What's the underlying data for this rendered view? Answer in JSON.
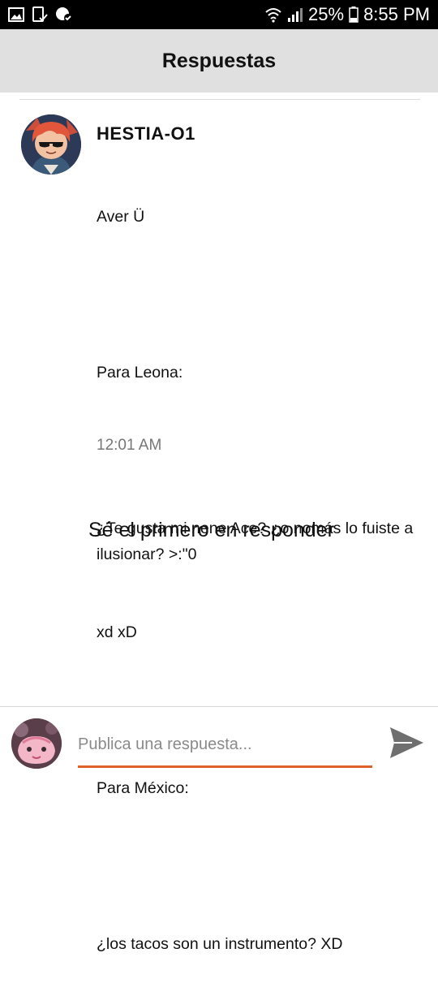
{
  "status_bar": {
    "battery": "25%",
    "time": "8:55 PM",
    "icons": [
      "image-icon",
      "phone-check-icon",
      "location-icon",
      "wifi-icon",
      "signal-icon",
      "battery-icon"
    ]
  },
  "header": {
    "title": "Respuestas"
  },
  "comment": {
    "author": "HESTIA-O1",
    "lines": [
      "Aver Ü",
      "",
      "Para Leona:",
      "",
      "¿Te gusta mi nene Ace? ¿o nomás lo fuiste a ilusionar? >:\"0",
      "xd xD",
      "",
      "Para México:",
      "",
      "¿los tacos son un instrumento? XD"
    ],
    "time": "12:01 AM"
  },
  "empty_state": {
    "message": "Sé el primero en responder"
  },
  "reply_bar": {
    "placeholder": "Publica una respuesta...",
    "value": ""
  },
  "colors": {
    "accent": "#e0602a",
    "header_bg": "#e0e0e0",
    "status_bar_bg": "#000000"
  }
}
